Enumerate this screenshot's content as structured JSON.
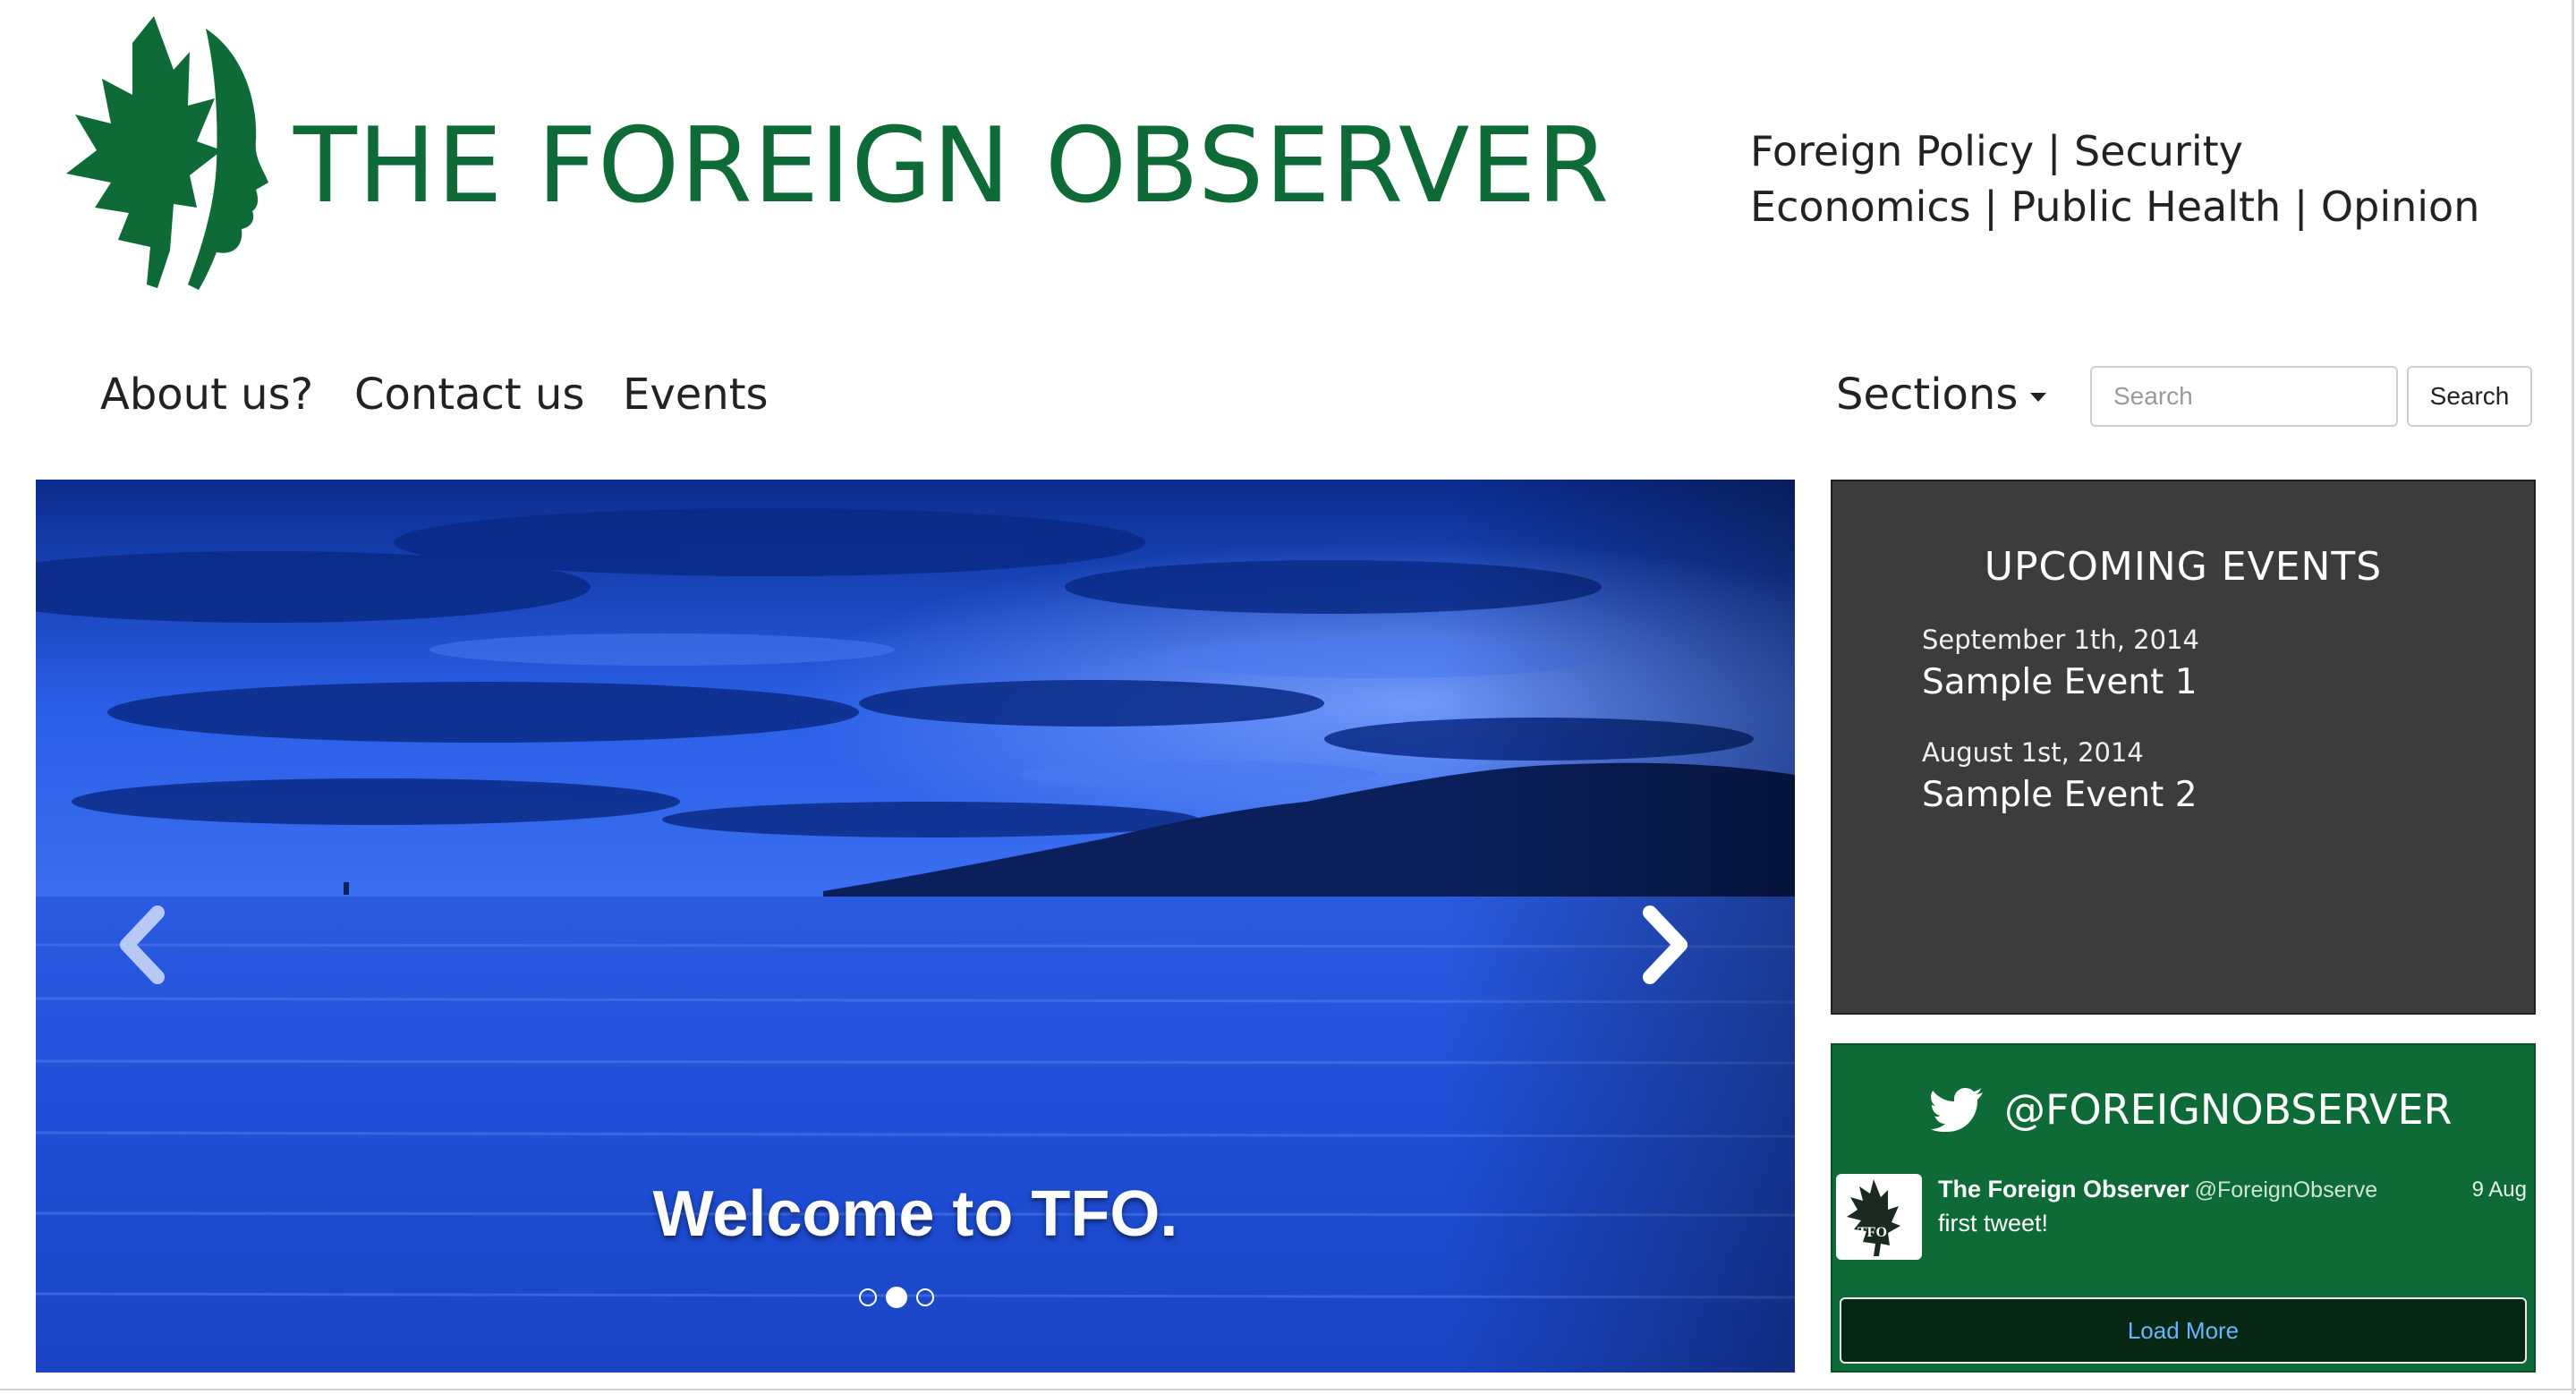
{
  "header": {
    "title": "THE FOREIGN OBSERVER",
    "tagline_line1": "Foreign Policy | Security",
    "tagline_line2": "Economics | Public Health | Opinion"
  },
  "nav": {
    "about": "About us?",
    "contact": "Contact us",
    "events": "Events",
    "sections": "Sections",
    "search_placeholder": "Search",
    "search_button": "Search"
  },
  "carousel": {
    "caption": "Welcome to TFO.",
    "slide_count": 3,
    "active_index": 1
  },
  "events": {
    "title": "UPCOMING EVENTS",
    "items": [
      {
        "date": "September 1th, 2014",
        "name": "Sample Event 1"
      },
      {
        "date": "August 1st, 2014",
        "name": "Sample Event 2"
      }
    ]
  },
  "twitter": {
    "handle": "@FOREIGNOBSERVER",
    "tweet": {
      "author": "The Foreign Observer",
      "screen_name": "@ForeignObserve",
      "date": "9 Aug",
      "text": "first tweet!",
      "avatar_label": "TFO"
    },
    "load_more": "Load More"
  },
  "colors": {
    "brand_green": "#0e6a36",
    "events_panel": "#3a3d3c",
    "carousel_blue": "#1d4ed8"
  }
}
